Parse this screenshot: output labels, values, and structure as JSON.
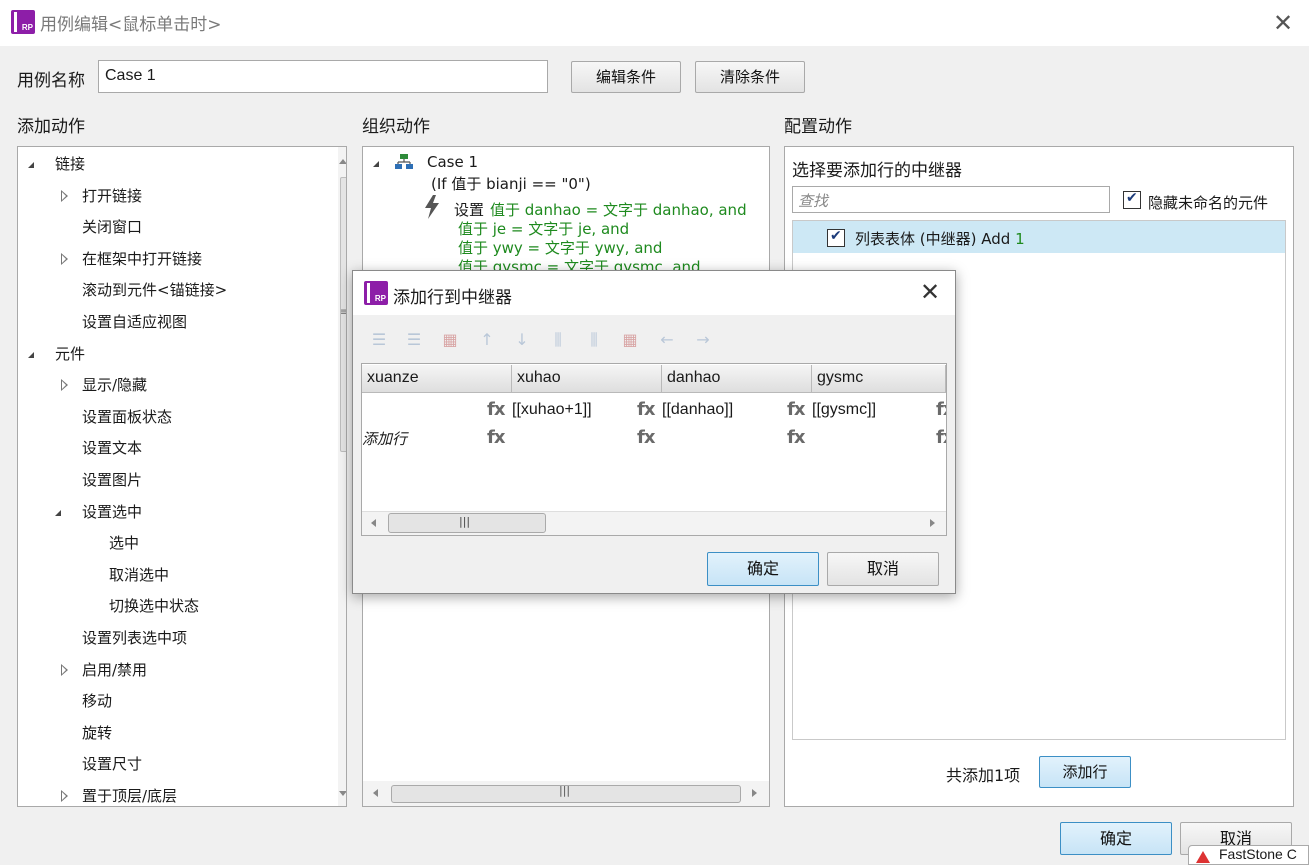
{
  "window": {
    "title": "用例编辑<鼠标单击时>",
    "close_icon": "close-icon",
    "logo_text": "RP"
  },
  "case_row": {
    "label": "用例名称",
    "name_value": "Case 1",
    "edit_condition_label": "编辑条件",
    "clear_condition_label": "清除条件"
  },
  "sections": {
    "add_action": "添加动作",
    "organize_action": "组织动作",
    "configure_action": "配置动作"
  },
  "action_tree": [
    {
      "label": "链接",
      "level": 0,
      "expanded": true
    },
    {
      "label": "打开链接",
      "level": 1,
      "expandable": true
    },
    {
      "label": "关闭窗口",
      "level": 1
    },
    {
      "label": "在框架中打开链接",
      "level": 1,
      "expandable": true
    },
    {
      "label": "滚动到元件<锚链接>",
      "level": 1
    },
    {
      "label": "设置自适应视图",
      "level": 1
    },
    {
      "label": "元件",
      "level": 0,
      "expanded": true
    },
    {
      "label": "显示/隐藏",
      "level": 1,
      "expandable": true
    },
    {
      "label": "设置面板状态",
      "level": 1
    },
    {
      "label": "设置文本",
      "level": 1
    },
    {
      "label": "设置图片",
      "level": 1
    },
    {
      "label": "设置选中",
      "level": 1,
      "expanded": true
    },
    {
      "label": "选中",
      "level": 2
    },
    {
      "label": "取消选中",
      "level": 2
    },
    {
      "label": "切换选中状态",
      "level": 2
    },
    {
      "label": "设置列表选中项",
      "level": 1
    },
    {
      "label": "启用/禁用",
      "level": 1,
      "expandable": true
    },
    {
      "label": "移动",
      "level": 1
    },
    {
      "label": "旋转",
      "level": 1
    },
    {
      "label": "设置尺寸",
      "level": 1
    },
    {
      "label": "置于顶层/底层",
      "level": 1,
      "expandable": true
    }
  ],
  "organize": {
    "case_name": "Case 1",
    "condition": "(If 值于 bianji == \"0\")",
    "action_prefix": "设置",
    "action_lines": [
      "值于 danhao = 文字于 danhao, and",
      "值于 je = 文字于 je, and",
      "值于 ywy = 文字于 ywy, and",
      "值于 gysmc = 文字于 gysmc, and"
    ]
  },
  "configure": {
    "subtitle": "选择要添加行的中继器",
    "search_placeholder": "查找",
    "hide_unnamed_label": "隐藏未命名的元件",
    "hide_unnamed_checked": true,
    "repeater_item_label": "列表表体 (中继器) Add",
    "repeater_item_count": "1",
    "repeater_item_checked": true,
    "total_label": "共添加1项",
    "add_row_label": "添加行"
  },
  "footer": {
    "ok_label": "确定",
    "cancel_label": "取消",
    "taskbar_app": "FastStone C"
  },
  "modal": {
    "title": "添加行到中继器",
    "columns": [
      "xuanze",
      "xuhao",
      "danhao",
      "gysmc"
    ],
    "rows": [
      [
        "",
        "[[xuhao+1]]",
        "[[danhao]]",
        "[[gysmc]]"
      ]
    ],
    "add_row_text": "添加行",
    "fx_label": "fx",
    "ok_label": "确定",
    "cancel_label": "取消",
    "toolbar_icons": [
      "insert-row-above-icon",
      "insert-row-below-icon",
      "delete-row-icon",
      "move-up-icon",
      "move-down-icon",
      "insert-col-left-icon",
      "insert-col-right-icon",
      "delete-col-icon",
      "move-left-icon",
      "move-right-icon"
    ]
  },
  "colors": {
    "accent_blue": "#3c8fc5",
    "selection_bg": "#cde8f5",
    "condition_green": "#1e8a1e",
    "logo_purple": "#8d1ea8"
  }
}
